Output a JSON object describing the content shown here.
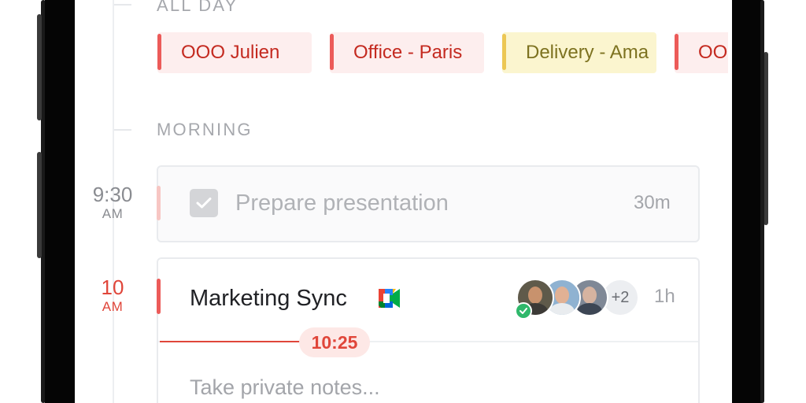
{
  "sections": {
    "all_day": "ALL DAY",
    "morning": "MORNING"
  },
  "all_day_events": [
    {
      "label": "OOO Julien",
      "color": "#ec5b59"
    },
    {
      "label": "Office - Paris",
      "color": "#ec5b59"
    },
    {
      "label": "Delivery - Ama",
      "color": "#ecc754"
    },
    {
      "label": "OO",
      "color": "#ec5b59"
    }
  ],
  "time_labels": {
    "t930": {
      "hour": "9:30",
      "ampm": "AM"
    },
    "t10": {
      "hour": "10",
      "ampm": "AM"
    }
  },
  "events": {
    "task": {
      "title": "Prepare presentation",
      "duration": "30m",
      "completed": true
    },
    "meeting": {
      "title": "Marketing Sync",
      "duration": "1h",
      "video_icon": "google-meet-icon",
      "extra_attendees": "+2",
      "notes_placeholder": "Take private notes..."
    }
  },
  "current_time": "10:25",
  "colors": {
    "accent_red": "#e0463a",
    "chip_red_text": "#c42a20",
    "chip_yellow_text": "#7d7220"
  }
}
